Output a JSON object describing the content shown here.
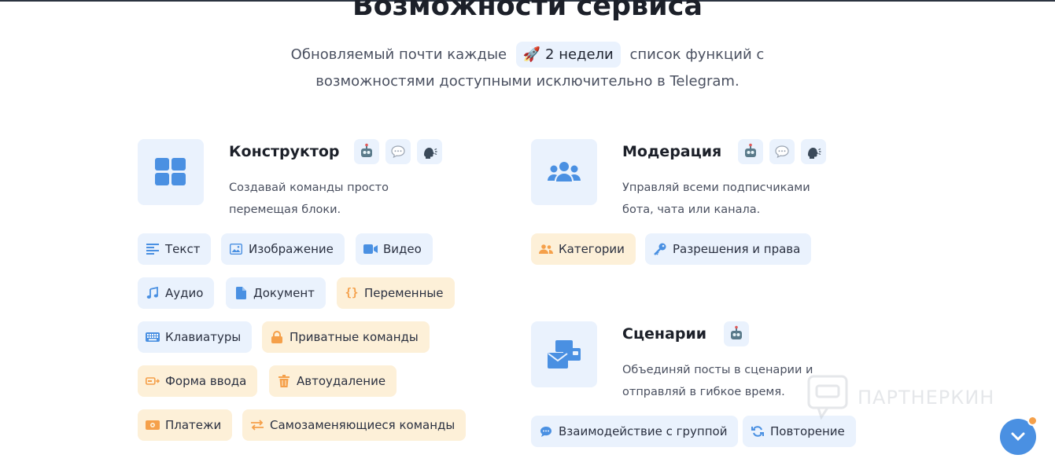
{
  "header": {
    "title": "Возможности сервиса",
    "subtitle_prefix": "Обновляемый почти каждые",
    "highlight_emoji": "🚀",
    "highlight_text": "2 недели",
    "subtitle_suffix": "список функций с",
    "subtitle_line2": "возможностями доступными исключительно в Telegram."
  },
  "features": {
    "constructor": {
      "title": "Конструктор",
      "desc_line1": "Создавай команды просто",
      "desc_line2": "перемещая блоки.",
      "chips": [
        "Текст",
        "Изображение",
        "Видео",
        "Аудио",
        "Документ",
        "Переменные",
        "Клавиатуры",
        "Приватные команды",
        "Форма ввода",
        "Автоудаление",
        "Платежи",
        "Самозаменяющиеся команды"
      ]
    },
    "moderation": {
      "title": "Модерация",
      "desc_line1": "Управляй всеми подписчиками",
      "desc_line2": "бота, чата или канала.",
      "chips": [
        "Категории",
        "Разрешения и права"
      ]
    },
    "scenarios": {
      "title": "Сценарии",
      "desc_line1": "Объединяй посты в сценарии и",
      "desc_line2": "отправляй в гибкое время.",
      "chips": [
        "Взаимодействие с группой",
        "Повторение"
      ]
    }
  },
  "watermark": {
    "text": "ПАРТНЕРКИН"
  },
  "colors": {
    "accent": "#4a90e2",
    "chip_blue_bg": "#eaf2fd",
    "chip_orange_bg": "#fdf0d8",
    "orange_icon": "#f5a04a"
  }
}
